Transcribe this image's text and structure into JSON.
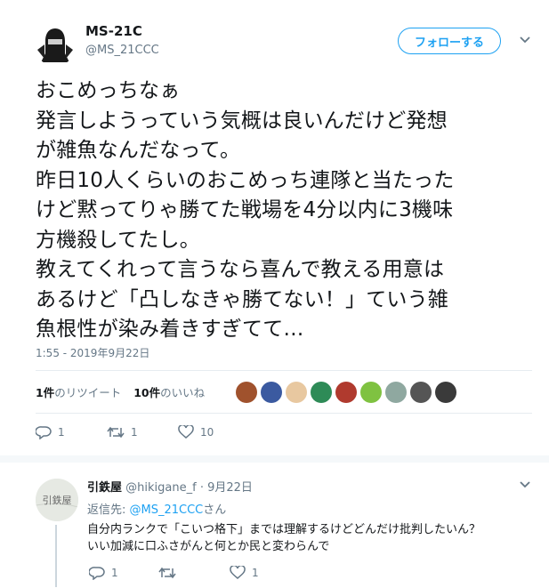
{
  "tweet": {
    "display_name": "MS-21C",
    "handle": "@MS_21CCC",
    "follow_label": "フォローする",
    "text_lines": [
      "おこめっちなぁ",
      "発言しようっていう気概は良いんだけど発想",
      "が雑魚なんだなって。",
      "昨日10人くらいのおこめっち連隊と当たった",
      "けど黙ってりゃ勝てた戦場を4分以内に3機味",
      "方機殺してたし。",
      "教えてくれって言うなら喜んで教える用意は",
      "あるけど「凸しなきゃ勝てない！」ていう雑",
      "魚根性が染み着きすぎてて…"
    ],
    "timestamp": "1:55 - 2019年9月22日",
    "retweets_count": "1件",
    "retweets_label": "のリツイート",
    "likes_count": "10件",
    "likes_label": "のいいね",
    "reply_count": "1",
    "retweet_count": "1",
    "like_count": "10"
  },
  "liker_colors": [
    "#a0522d",
    "#3b5aa0",
    "#e8c8a0",
    "#2e8b57",
    "#b03a2e",
    "#7fc241",
    "#8fa8a0",
    "#555555",
    "#3a3a3a"
  ],
  "icons": {
    "reply": "reply-icon",
    "retweet": "retweet-icon",
    "like": "heart-icon",
    "menu": "chevron-down-icon"
  },
  "reply": {
    "display_name": "引鉄屋",
    "handle": "@hikigane_f",
    "date": "9月22日",
    "replying_to_prefix": "返信先: ",
    "replying_to_handle": "@MS_21CCC",
    "replying_to_suffix": "さん",
    "text_line1": "自分内ランクで「こいつ格下」までは理解するけどどんだけ批判したいん？",
    "text_line2": "いい加減に口ふさがんと何とか民と変わらんで",
    "avatar_text": "引鉄屋",
    "reply_count": "1",
    "retweet_count": "",
    "like_count": "1"
  }
}
